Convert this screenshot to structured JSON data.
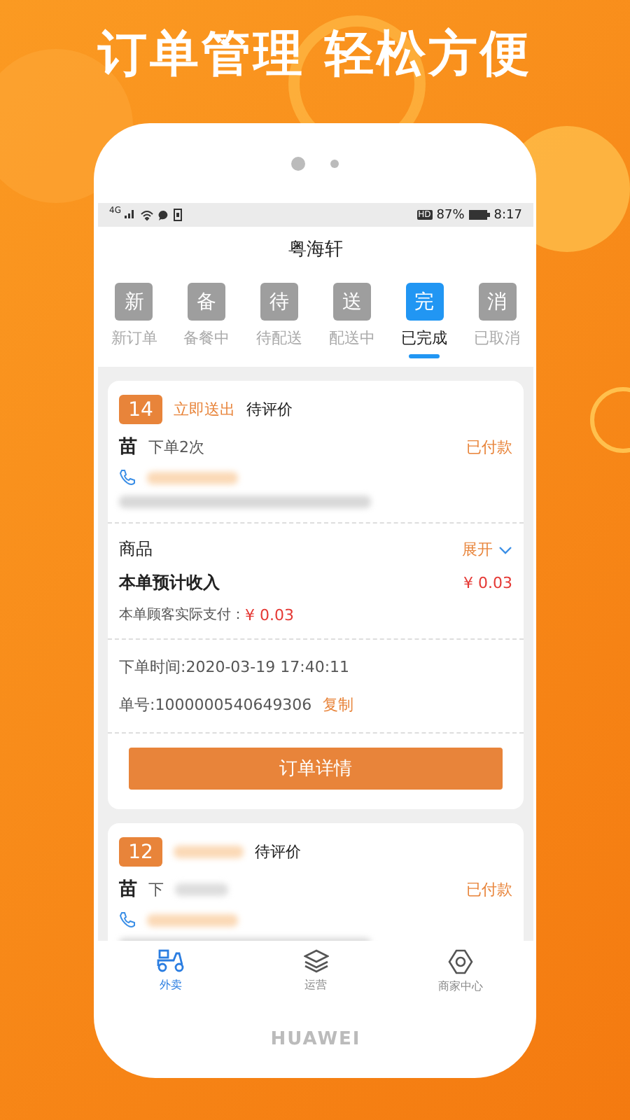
{
  "headline": "订单管理 轻松方便",
  "status_bar": {
    "network": "4G",
    "hd": "HD",
    "battery": "87%",
    "time": "8:17"
  },
  "title": "粤海轩",
  "tabs": [
    {
      "icon": "新",
      "label": "新订单",
      "selected": false
    },
    {
      "icon": "备",
      "label": "备餐中",
      "selected": false
    },
    {
      "icon": "待",
      "label": "待配送",
      "selected": false
    },
    {
      "icon": "送",
      "label": "配送中",
      "selected": false
    },
    {
      "icon": "完",
      "label": "已完成",
      "selected": true
    },
    {
      "icon": "消",
      "label": "已取消",
      "selected": false
    }
  ],
  "orders": [
    {
      "number": "14",
      "delivery": "立即送出",
      "status": "待评价",
      "customer": "苗",
      "order_count": "下单2次",
      "payment": "已付款",
      "goods_label": "商品",
      "expand": "展开",
      "income_label": "本单预计收入",
      "income": "¥ 0.03",
      "paid_label": "本单顾客实际支付：",
      "paid": "¥ 0.03",
      "time": "下单时间:2020-03-19 17:40:11",
      "order_no": "单号:1000000540649306",
      "copy": "复制",
      "detail_button": "订单详情"
    },
    {
      "number": "12",
      "status": "待评价",
      "customer": "苗",
      "order_count": "下",
      "payment": "已付款"
    }
  ],
  "nav": [
    {
      "kind": "scooter",
      "label": "外卖",
      "selected": true
    },
    {
      "kind": "layers",
      "label": "运营",
      "selected": false
    },
    {
      "kind": "gear",
      "label": "商家中心",
      "selected": false
    }
  ],
  "brand": "HUAWEI"
}
